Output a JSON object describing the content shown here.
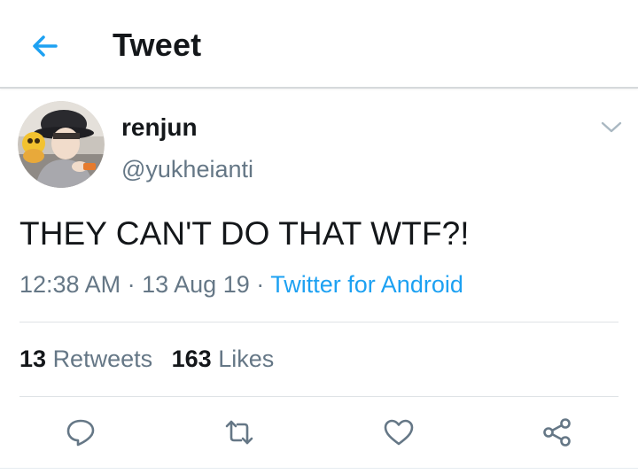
{
  "header": {
    "title": "Tweet",
    "back_icon": "arrow-left-icon"
  },
  "tweet": {
    "display_name": "renjun",
    "handle": "@yukheianti",
    "text": "THEY CAN'T DO THAT WTF?!",
    "time": "12:38 AM",
    "date": "13 Aug 19",
    "source": "Twitter for Android",
    "separator": "·"
  },
  "stats": {
    "retweets_count": "13",
    "retweets_label": "Retweets",
    "likes_count": "163",
    "likes_label": "Likes"
  },
  "actions": [
    "reply-icon",
    "retweet-icon",
    "like-icon",
    "share-icon"
  ],
  "colors": {
    "accent": "#1da1f2",
    "text_primary": "#14171a",
    "text_secondary": "#657786",
    "icon_gray": "#657786",
    "divider": "#dfe3e6"
  }
}
